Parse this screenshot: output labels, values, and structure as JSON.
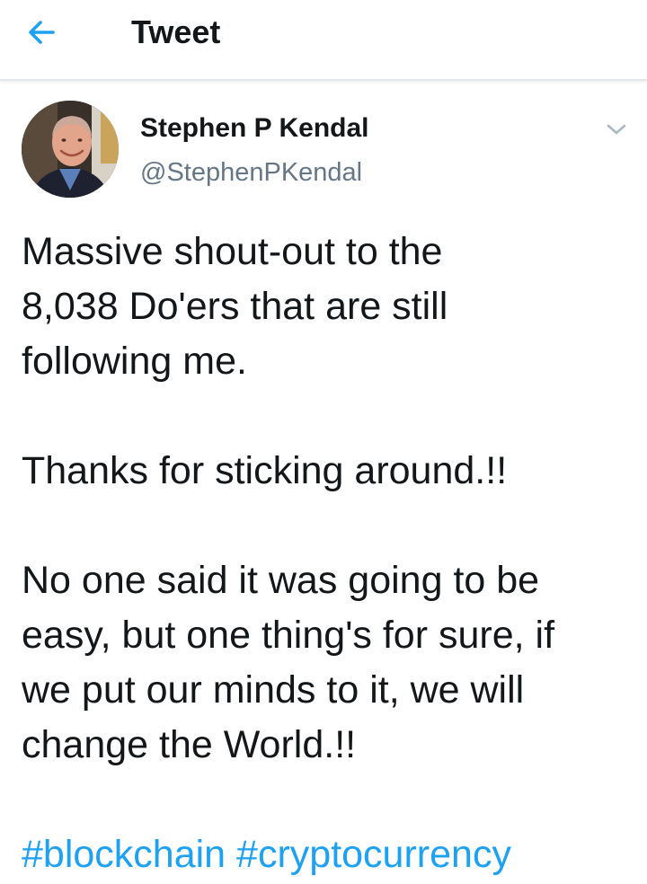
{
  "header": {
    "back_icon": "arrow-left-icon",
    "title": "Tweet",
    "accent_color": "#1da1f2"
  },
  "tweet": {
    "author": {
      "display_name": "Stephen P Kendal",
      "handle": "@StephenPKendal"
    },
    "menu_icon": "chevron-down-icon",
    "paragraphs": [
      [
        "Massive shout-out to the",
        "8,038 Do'ers that are still",
        "following me."
      ],
      [
        "Thanks for sticking around.!!"
      ],
      [
        "No one said it was going to be",
        "easy, but one thing's for sure, if",
        "we put our minds to it, we will",
        "change the World.!!"
      ]
    ],
    "hashtags": [
      "#blockchain",
      "#cryptocurrency"
    ]
  }
}
